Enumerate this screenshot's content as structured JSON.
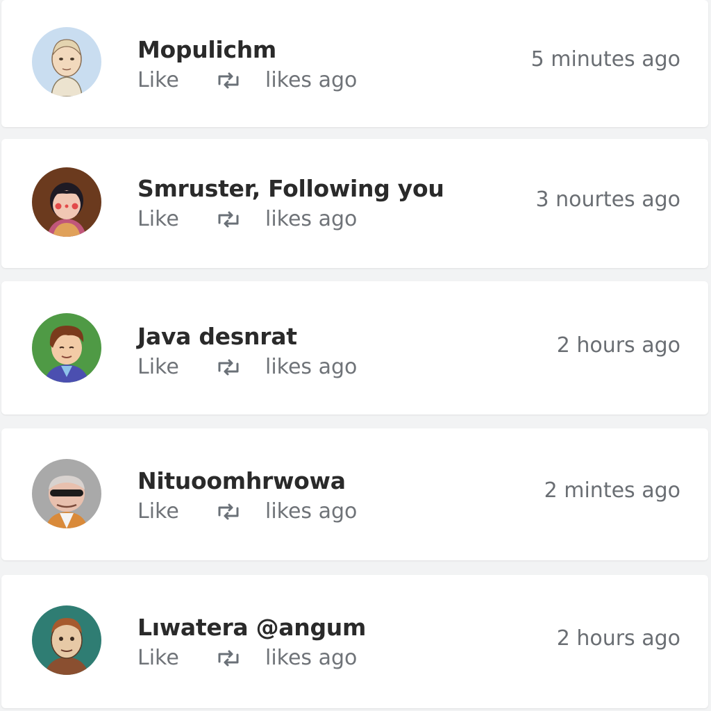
{
  "notifications": [
    {
      "name": "Mopulichm",
      "like_label": "Like",
      "retweet_icon": "retweet-icon",
      "meta": "likes ago",
      "time": "5 minutes ago",
      "avatar_bg": "#c9ddf0"
    },
    {
      "name": "Smruster, Following you",
      "like_label": "Like",
      "retweet_icon": "retweet-icon",
      "meta": "likes ago",
      "time": "3 nourtes ago",
      "avatar_bg": "#6b3a1e"
    },
    {
      "name": "Java desnrat",
      "like_label": "Like",
      "retweet_icon": "retweet-icon",
      "meta": "likes ago",
      "time": "2 hours ago",
      "avatar_bg": "#4f9a45"
    },
    {
      "name": "Nituoomhrwowa",
      "like_label": "Like",
      "retweet_icon": "retweet-icon",
      "meta": "likes ago",
      "time": "2 mintes ago",
      "avatar_bg": "#a9a9a9"
    },
    {
      "name": "Lıwatera @angum",
      "like_label": "Like",
      "retweet_icon": "retweet-icon",
      "meta": "likes ago",
      "time": "2 hours ago",
      "avatar_bg": "#2f7d73"
    }
  ]
}
